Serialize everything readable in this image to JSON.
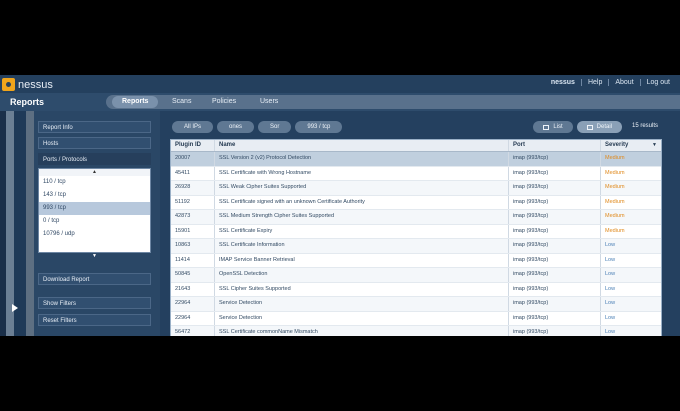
{
  "app": {
    "logo_text": "nessus"
  },
  "user_links": [
    "nessus",
    "Help",
    "About",
    "Log out"
  ],
  "nav": {
    "title": "Reports",
    "tabs": [
      {
        "label": "Reports",
        "active": true
      },
      {
        "label": "Scans",
        "active": false
      },
      {
        "label": "Policies",
        "active": false
      },
      {
        "label": "Users",
        "active": false
      }
    ]
  },
  "sidebar": {
    "report_info": "Report Info",
    "hosts": "Hosts",
    "ports_protocols": "Ports / Protocols",
    "list_items": [
      "110 / tcp",
      "143 / tcp",
      "993 / tcp",
      "0 / tcp",
      "0 / udp",
      "10796 / udp"
    ],
    "selected_index": 2,
    "download_report": "Download Report",
    "show_filters": "Show Filters",
    "reset_filters": "Reset Filters"
  },
  "main": {
    "breadcrumbs": [
      "All IPs",
      "ones",
      "Sor",
      "993 / tcp"
    ],
    "view_buttons": [
      {
        "label": "List",
        "active": false,
        "icon": "list-icon"
      },
      {
        "label": "Detail",
        "active": true,
        "icon": "detail-icon"
      }
    ],
    "results": "15 results",
    "columns": [
      "Plugin ID",
      "Name",
      "Port",
      "Severity"
    ],
    "rows": [
      {
        "id": "20007",
        "name": "SSL Version 2 (v2) Protocol Detection",
        "port": "imap (993/tcp)",
        "severity": "Medium",
        "sev": "medium"
      },
      {
        "id": "45411",
        "name": "SSL Certificate with Wrong Hostname",
        "port": "imap (993/tcp)",
        "severity": "Medium",
        "sev": "medium"
      },
      {
        "id": "26928",
        "name": "SSL Weak Cipher Suites Supported",
        "port": "imap (993/tcp)",
        "severity": "Medium",
        "sev": "medium"
      },
      {
        "id": "51192",
        "name": "SSL Certificate signed with an unknown Certificate Authority",
        "port": "imap (993/tcp)",
        "severity": "Medium",
        "sev": "medium"
      },
      {
        "id": "42873",
        "name": "SSL Medium Strength Cipher Suites Supported",
        "port": "imap (993/tcp)",
        "severity": "Medium",
        "sev": "medium"
      },
      {
        "id": "15901",
        "name": "SSL Certificate Expiry",
        "port": "imap (993/tcp)",
        "severity": "Medium",
        "sev": "medium"
      },
      {
        "id": "10863",
        "name": "SSL Certificate Information",
        "port": "imap (993/tcp)",
        "severity": "Low",
        "sev": "low"
      },
      {
        "id": "11414",
        "name": "IMAP Service Banner Retrieval",
        "port": "imap (993/tcp)",
        "severity": "Low",
        "sev": "low"
      },
      {
        "id": "50845",
        "name": "OpenSSL Detection",
        "port": "imap (993/tcp)",
        "severity": "Low",
        "sev": "low"
      },
      {
        "id": "21643",
        "name": "SSL Cipher Suites Supported",
        "port": "imap (993/tcp)",
        "severity": "Low",
        "sev": "low"
      },
      {
        "id": "22964",
        "name": "Service Detection",
        "port": "imap (993/tcp)",
        "severity": "Low",
        "sev": "low"
      },
      {
        "id": "22964",
        "name": "Service Detection",
        "port": "imap (993/tcp)",
        "severity": "Low",
        "sev": "low"
      },
      {
        "id": "56472",
        "name": "SSL Certificate commonName Mismatch",
        "port": "imap (993/tcp)",
        "severity": "Low",
        "sev": "low"
      }
    ]
  }
}
